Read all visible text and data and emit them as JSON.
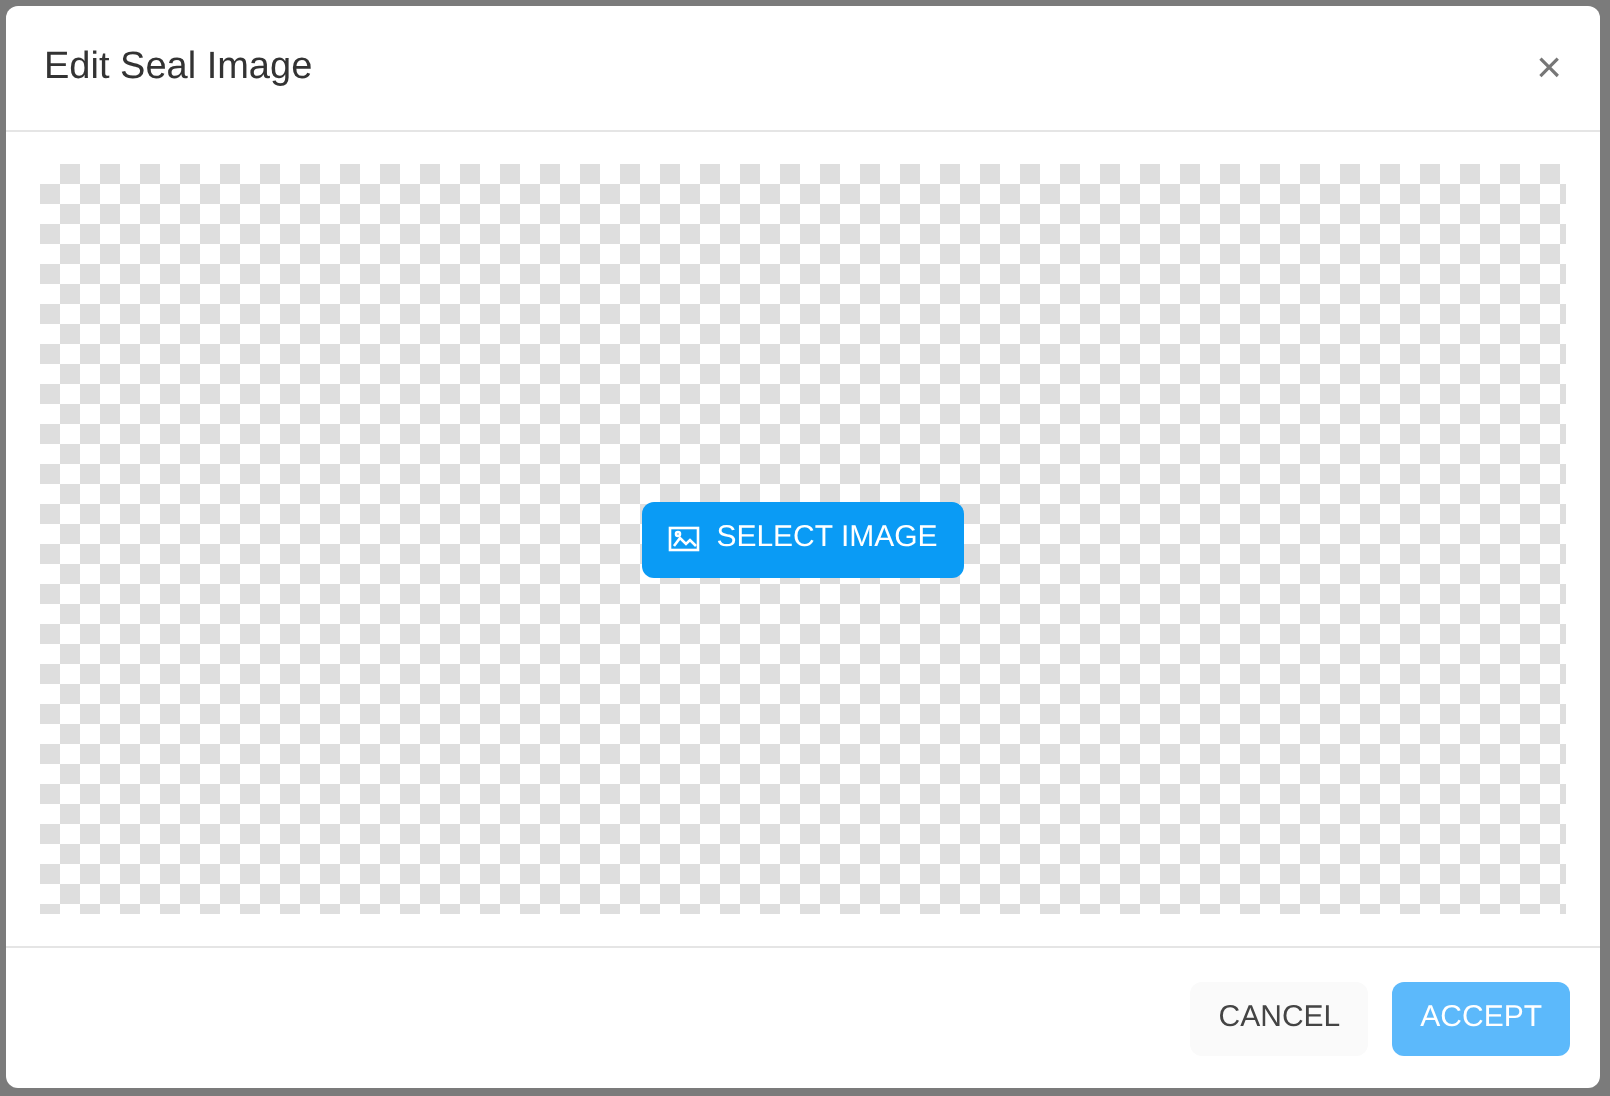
{
  "dialog": {
    "title": "Edit Seal Image",
    "close": "×"
  },
  "canvas": {
    "select_button": "SELECT IMAGE"
  },
  "buttons": [
    {
      "kind": "secondary",
      "label": "CANCEL",
      "disabled": false
    },
    {
      "kind": "primary",
      "label": "ACCEPT",
      "disabled": true
    }
  ]
}
